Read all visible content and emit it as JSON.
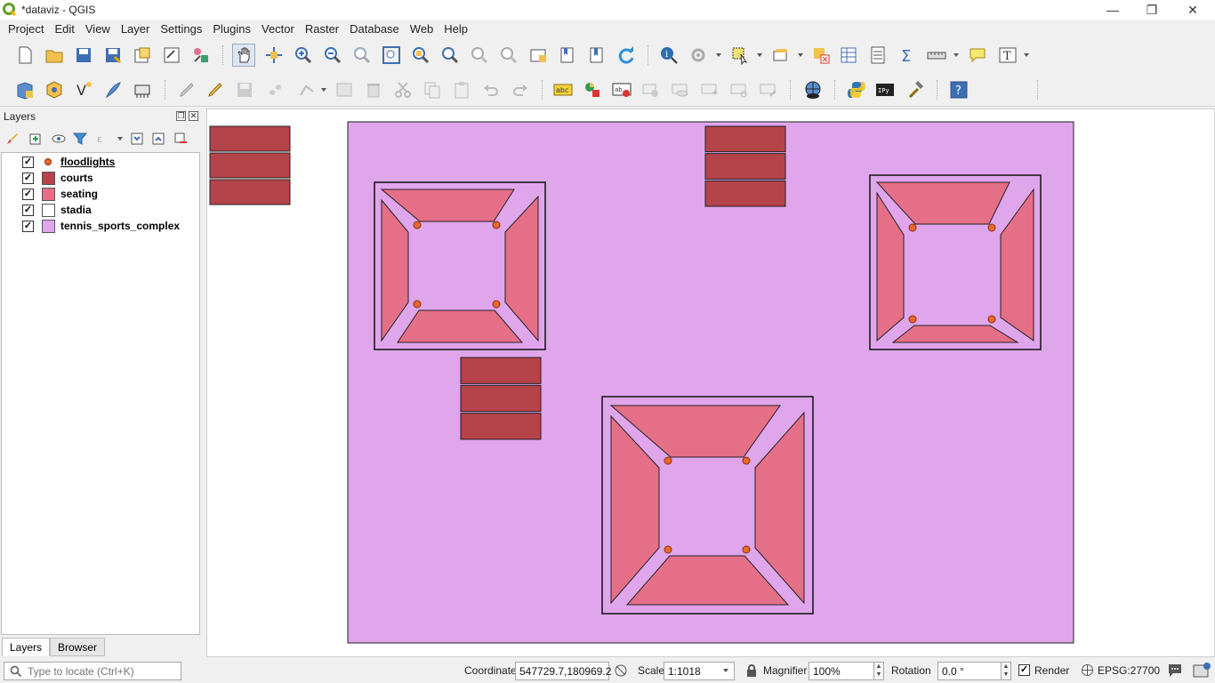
{
  "window": {
    "title": "*dataviz - QGIS",
    "minimize_glyph": "—",
    "maximize_glyph": "❐",
    "close_glyph": "✕"
  },
  "menu": [
    "Project",
    "Edit",
    "View",
    "Layer",
    "Settings",
    "Plugins",
    "Vector",
    "Raster",
    "Database",
    "Web",
    "Help"
  ],
  "layers_panel": {
    "title": "Layers",
    "float_glyph": "❐",
    "close_glyph": "✕",
    "layers": [
      {
        "name": "floodlights",
        "checked": "✓",
        "symbol": "point",
        "color": "#e8682a"
      },
      {
        "name": "courts",
        "checked": "✓",
        "symbol": "fill",
        "color": "#b5434a"
      },
      {
        "name": "seating",
        "checked": "✓",
        "symbol": "fill",
        "color": "#e66f88"
      },
      {
        "name": "stadia",
        "checked": "✓",
        "symbol": "fill",
        "color": "#ffffff"
      },
      {
        "name": "tennis_sports_complex",
        "checked": "✓",
        "symbol": "fill",
        "color": "#dfa6ec"
      }
    ],
    "tabs": [
      "Layers",
      "Browser"
    ]
  },
  "map_colors": {
    "complex": "#dfa6ec",
    "stadium_outline": "#111111",
    "seating": "#e66f88",
    "court": "#b5434a",
    "floodlight": "#e8682a"
  },
  "statusbar": {
    "locator_placeholder": "Type to locate (Ctrl+K)",
    "coordinate_label": "Coordinate",
    "coordinate_value": "547729.7,180969.2",
    "scale_label": "Scale",
    "scale_value": "1:1018",
    "magnifier_label": "Magnifier",
    "magnifier_value": "100%",
    "rotation_label": "Rotation",
    "rotation_value": "0.0 °",
    "render_label": "Render",
    "render_checked": "✓",
    "crs": "EPSG:27700"
  }
}
